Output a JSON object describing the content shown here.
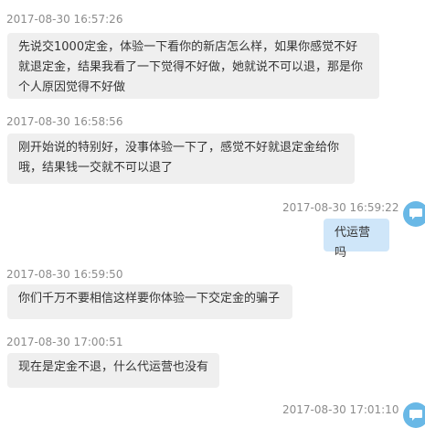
{
  "messages": [
    {
      "timestamp": "2017-08-30 16:57:26",
      "direction": "incoming",
      "lines": [
        "先说交1000定金，体验一下看你的新店怎么样，如果你感觉不好",
        "就退定金，结果我看了一下觉得不好做，她就说不可以退，那是你",
        "个人原因觉得不好做"
      ]
    },
    {
      "timestamp": "2017-08-30 16:58:56",
      "direction": "incoming",
      "lines": [
        "刚开始说的特别好，没事体验一下了，感觉不好就退定金给你",
        "哦，结果钱一交就不可以退了"
      ]
    },
    {
      "timestamp": "2017-08-30 16:59:22",
      "direction": "outgoing",
      "lines": [
        "代运营吗"
      ]
    },
    {
      "timestamp": "2017-08-30 16:59:50",
      "direction": "incoming",
      "lines": [
        "你们千万不要相信这样要你体验一下交定金的骗子"
      ]
    },
    {
      "timestamp": "2017-08-30 17:00:51",
      "direction": "incoming",
      "lines": [
        "现在是定金不退，什么代运营也没有"
      ]
    },
    {
      "timestamp": "2017-08-30 17:01:10",
      "direction": "outgoing",
      "lines": []
    }
  ],
  "colors": {
    "incoming_bubble": "#efefef",
    "outgoing_bubble": "#cfe6f9",
    "avatar": "#69b8e6",
    "timestamp_text": "#8c8c8c"
  },
  "icons": {
    "avatar": "avatar-icon"
  }
}
